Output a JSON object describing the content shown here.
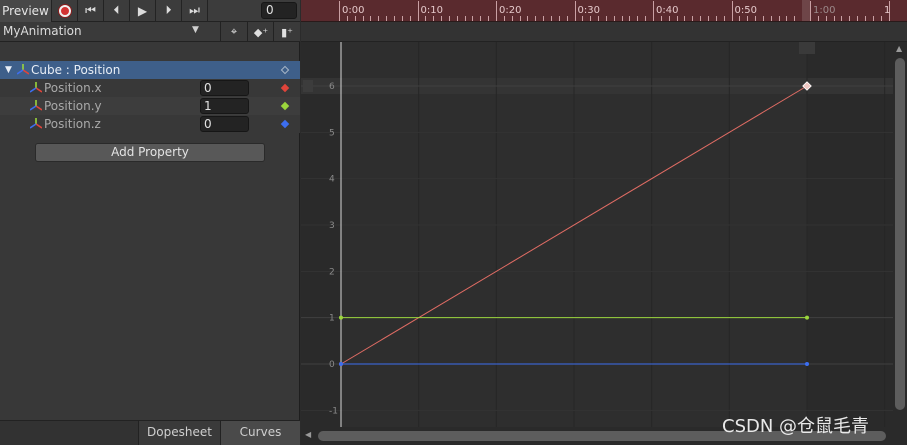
{
  "toolbar": {
    "preview_label": "Preview",
    "frame_value": "0"
  },
  "clip": {
    "name": "MyAnimation"
  },
  "properties": {
    "group_label": "Cube : Position",
    "items": [
      {
        "label": "Position.x",
        "value": "0",
        "color": "#e0443a"
      },
      {
        "label": "Position.y",
        "value": "1",
        "color": "#9bd63c"
      },
      {
        "label": "Position.z",
        "value": "0",
        "color": "#3c6ef0"
      }
    ]
  },
  "add_property_label": "Add Property",
  "tabs": {
    "dopesheet": "Dopesheet",
    "curves": "Curves"
  },
  "timeline": {
    "ticks": [
      "0:00",
      "0:10",
      "0:20",
      "0:30",
      "0:40",
      "0:50",
      "1:00",
      "1"
    ]
  },
  "chart_data": {
    "type": "line",
    "x": [
      0,
      60
    ],
    "series": [
      {
        "values": [
          0,
          6
        ],
        "color": "#e06c64"
      },
      {
        "values": [
          1,
          1
        ],
        "color": "#9bd63c"
      },
      {
        "values": [
          0,
          0
        ],
        "color": "#3c6ef0"
      }
    ],
    "y_ticks": [
      "6",
      "5",
      "4",
      "3",
      "2",
      "1",
      "0",
      "-1"
    ],
    "xlim": [
      0,
      60
    ],
    "ylim": [
      -1,
      6
    ]
  },
  "watermark": "CSDN @仓鼠毛青"
}
